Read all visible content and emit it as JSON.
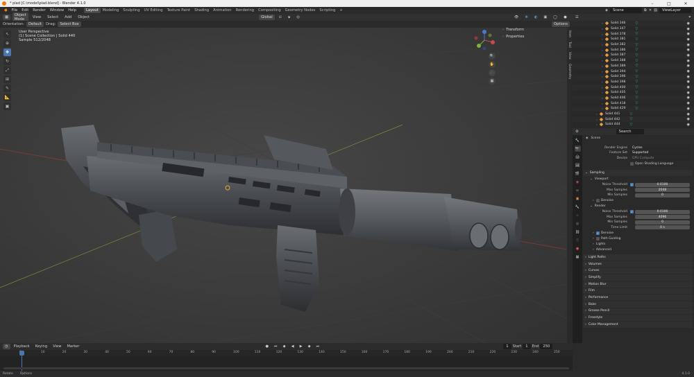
{
  "title": "* plad [C:\\model\\plad.blend] - Blender 4.1.0",
  "menu": [
    "File",
    "Edit",
    "Render",
    "Window",
    "Help"
  ],
  "workspaces": [
    "Layout",
    "Modeling",
    "Sculpting",
    "UV Editing",
    "Texture Paint",
    "Shading",
    "Animation",
    "Rendering",
    "Compositing",
    "Geometry Nodes",
    "Scripting"
  ],
  "active_workspace": "Layout",
  "scene_label": "Scene",
  "view_layer_label": "ViewLayer",
  "viewport_header": {
    "mode": "Object Mode",
    "view": "View",
    "select": "Select",
    "add": "Add",
    "object": "Object",
    "orientation_label": "Orientation:",
    "orientation": "Default",
    "drag_label": "Drag:",
    "drag": "Select Box",
    "transform": "Global",
    "options": "Options"
  },
  "viewport_info": {
    "line1": "User Perspective",
    "line2": "(1) Scene Collection | Solid 440",
    "line3": "Sample 512/2048"
  },
  "npanel": {
    "transform": "Transform",
    "properties": "Properties"
  },
  "npanel_tabs": [
    "Item",
    "Tool",
    "View",
    "Geometry"
  ],
  "outliner_items": [
    "Solid 346",
    "Solid 347",
    "Solid 378",
    "Solid 381",
    "Solid 382",
    "Solid 386",
    "Solid 387",
    "Solid 388",
    "Solid 389",
    "Solid 394",
    "Solid 396",
    "Solid 398",
    "Solid 400",
    "Solid 405",
    "Solid 406",
    "Solid 418",
    "Solid 429",
    "Solid 441",
    "Solid 442",
    "Solid 444"
  ],
  "props": {
    "search_placeholder": "Search",
    "scene": "Scene",
    "render_engine_label": "Render Engine",
    "render_engine": "Cycles",
    "feature_set_label": "Feature Set",
    "feature_set": "Supported",
    "device_label": "Device",
    "device": "GPU Compute",
    "osl": "Open Shading Language",
    "sampling": "Sampling",
    "viewport": "Viewport",
    "noise_threshold_label": "Noise Threshold",
    "vp_noise": "0.0100",
    "max_samples_label": "Max Samples",
    "vp_max": "2048",
    "min_samples_label": "Min Samples",
    "vp_min": "0",
    "denoise": "Denoise",
    "render": "Render",
    "r_noise": "0.0100",
    "r_max": "4096",
    "r_min": "0",
    "time_limit_label": "Time Limit",
    "time_limit": "0 s",
    "path_guiding": "Path Guiding",
    "lights": "Lights",
    "advanced": "Advanced",
    "sections": [
      "Light Paths",
      "Volumes",
      "Curves",
      "Simplify",
      "Motion Blur",
      "Film",
      "Performance",
      "Bake",
      "Grease Pencil",
      "Freestyle",
      "Color Management"
    ]
  },
  "timeline": {
    "playback": "Playback",
    "keying": "Keying",
    "view": "View",
    "marker": "Marker",
    "current": "1",
    "start_label": "Start",
    "start": "1",
    "end_label": "End",
    "end": "250",
    "ticks": [
      "0",
      "10",
      "20",
      "30",
      "40",
      "50",
      "60",
      "70",
      "80",
      "90",
      "100",
      "110",
      "120",
      "130",
      "140",
      "150",
      "160",
      "170",
      "180",
      "190",
      "200",
      "210",
      "220",
      "230",
      "240",
      "250"
    ]
  },
  "status": {
    "left": "Rotate",
    "mid": "Options",
    "version": "4.1.0"
  }
}
